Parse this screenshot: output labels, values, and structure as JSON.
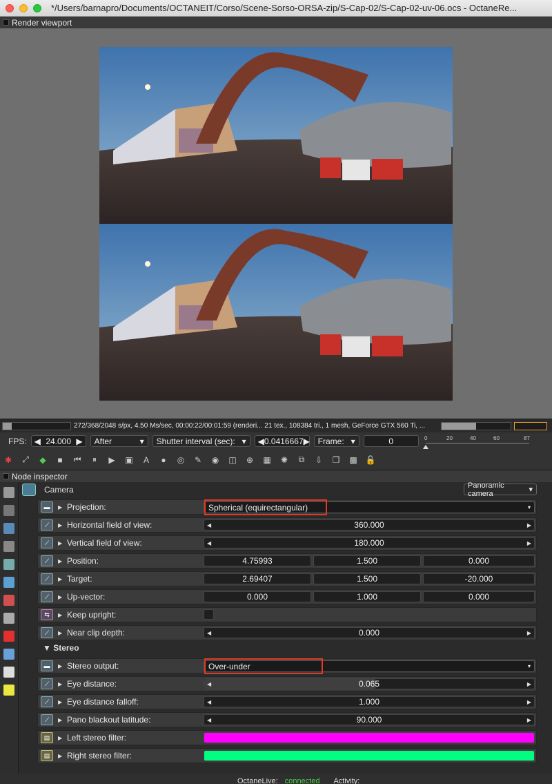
{
  "window": {
    "title": "*/Users/barnapro/Documents/OCTANEIT/Corso/Scene-Sorso-ORSA-zip/S-Cap-02/S-Cap-02-uv-06.ocs - OctaneRe..."
  },
  "viewport": {
    "title": "Render viewport",
    "image_desc": "Over-under stereo panorama: gas station, steel arch, concrete wall, red and white barriers"
  },
  "status": {
    "text": "272/368/2048 s/px, 4.50 Ms/sec, 00:00:22/00:01:59 (renderi... 21 tex., 108384 tri., 1 mesh, GeForce GTX 560 Ti, ...",
    "progress": 0.13,
    "gpu_progress": 0.5
  },
  "controls": {
    "fps_label": "FPS:",
    "fps_value": "24.000",
    "after": "After",
    "shutter": "Shutter interval (sec):",
    "shutter_value": "0.0416667",
    "frame_label": "Frame:",
    "frame_value": "0",
    "ticks": [
      "0",
      "20",
      "40",
      "60",
      "87"
    ]
  },
  "inspector": {
    "title": "Node inspector",
    "camera_label": "Camera",
    "camera_type": "Panoramic camera",
    "rows": [
      {
        "label": "Projection:",
        "value": "Spherical (equirectangular)"
      },
      {
        "label": "Horizontal field of view:",
        "value": "360.000"
      },
      {
        "label": "Vertical field of view:",
        "value": "180.000"
      },
      {
        "label": "Position:",
        "values": [
          "4.75993",
          "1.500",
          "0.000"
        ]
      },
      {
        "label": "Target:",
        "values": [
          "2.69407",
          "1.500",
          "-20.000"
        ]
      },
      {
        "label": "Up-vector:",
        "values": [
          "0.000",
          "1.000",
          "0.000"
        ]
      },
      {
        "label": "Keep upright:"
      },
      {
        "label": "Near clip depth:",
        "value": "0.000"
      }
    ],
    "stereo_header": "▼ Stereo",
    "stereo_rows": [
      {
        "label": "Stereo output:",
        "value": "Over-under"
      },
      {
        "label": "Eye distance:",
        "value": "0.065",
        "fill": 0.52
      },
      {
        "label": "Eye distance falloff:",
        "value": "1.000"
      },
      {
        "label": "Pano blackout latitude:",
        "value": "90.000"
      },
      {
        "label": "Left stereo filter:",
        "color": "#ff00ff"
      },
      {
        "label": "Right stereo filter:",
        "color": "#00ff80"
      }
    ]
  },
  "footer": {
    "octanelive": "OctaneLive:",
    "status": "connected",
    "activity": "Activity:"
  }
}
